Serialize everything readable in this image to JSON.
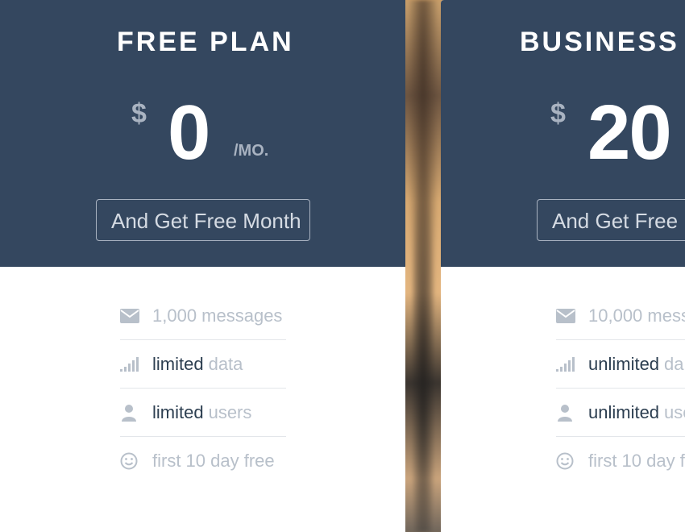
{
  "plans": [
    {
      "title": "FREE PLAN",
      "currency": "$",
      "price": "0",
      "period": "/MO.",
      "cta_label": "And Get Free Month",
      "features": [
        {
          "icon": "envelope-icon",
          "strong": "",
          "text": "1,000 messages"
        },
        {
          "icon": "signal-icon",
          "strong": "limited",
          "text": "data"
        },
        {
          "icon": "user-icon",
          "strong": "limited",
          "text": "users"
        },
        {
          "icon": "smiley-icon",
          "strong": "",
          "text": "first 10 day free"
        }
      ]
    },
    {
      "title": "BUSINESS",
      "currency": "$",
      "price": "20",
      "cta_label": "And Get Free M",
      "features": [
        {
          "icon": "envelope-icon",
          "strong": "",
          "text": "10,000 mess"
        },
        {
          "icon": "signal-icon",
          "strong": "unlimited",
          "text": "da"
        },
        {
          "icon": "user-icon",
          "strong": "unlimited",
          "text": "use"
        },
        {
          "icon": "smiley-icon",
          "strong": "",
          "text": "first 10 day f"
        }
      ]
    }
  ],
  "colors": {
    "header_bg": "#34475f",
    "muted_text": "#b8c0ca",
    "strong_text": "#2c3e50"
  }
}
